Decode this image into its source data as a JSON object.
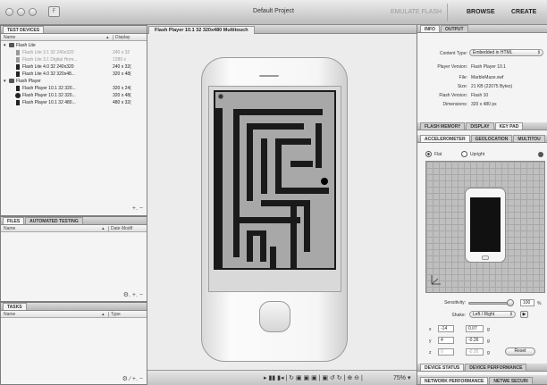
{
  "window": {
    "title": "Default Project",
    "emulate_label": "EMULATE FLASH",
    "browse_label": "BROWSE",
    "create_label": "CREATE",
    "app_icon_glyph": "F"
  },
  "left": {
    "test_devices": {
      "tab": "TEST DEVICES",
      "col_name": "Name",
      "col_display": "Display",
      "groups": [
        {
          "label": "Flash Lite",
          "items": [
            {
              "name": "Flash Lite 3.1 32 240x320",
              "display": "240 x 32",
              "dim": true
            },
            {
              "name": "Flash Lite 3.1 Digital Hom...",
              "display": "1280 x",
              "dim": true
            },
            {
              "name": "Flash Lite 4.0 32 240x320",
              "display": "240 x 32(",
              "dim": false
            },
            {
              "name": "Flash Lite 4.0 32 320x48...",
              "display": "320 x 48(",
              "dim": false
            }
          ]
        },
        {
          "label": "Flash Player",
          "items": [
            {
              "name": "Flash Player 10.1 32 320...",
              "display": "320 x 24(",
              "dim": false
            },
            {
              "name": "Flash Player 10.1 32 320...",
              "display": "320 x 48(",
              "dim": false
            },
            {
              "name": "Flash Player 10.1 32 480...",
              "display": "480 x 32(",
              "dim": false
            }
          ]
        }
      ],
      "footer": "+.  −"
    },
    "files": {
      "tab1": "FILES",
      "tab2": "AUTOMATED TESTING",
      "col_name": "Name",
      "col_date": "Date Modif",
      "footer": "⚙.  +.  −"
    },
    "tasks": {
      "tab": "TASKS",
      "col_name": "Name",
      "col_type": "Type",
      "footer": "⚙  ∕  +.  −"
    }
  },
  "center": {
    "tab": "Flash Player 10.1 32 320x480 Multitouch",
    "playback": {
      "controls": "▸  ▮▮  ▮◂  |  ↻  ▣  ▣  ▣  |  ▣  ↺  ↻  |  ⊕  ⊖  |",
      "zoom": "75% ▾"
    }
  },
  "right": {
    "info_tab": "INFO",
    "output_tab": "OUTPUT",
    "content_type_label": "Content Type:",
    "content_type_value": "Embedded in HTML",
    "player_version_label": "Player Version:",
    "player_version_value": "Flash Player 10.1",
    "file_label": "File:",
    "file_value": "MarbleMaze.swf",
    "size_label": "Size:",
    "size_value": "21 KB (22075 Bytes)",
    "flash_version_label": "Flash Version:",
    "flash_version_value": "Flash 10",
    "dimensions_label": "Dimensions:",
    "dimensions_value": "320 x 480 px",
    "tabs2": [
      "FLASH MEMORY",
      "DISPLAY",
      "KEY PAD"
    ],
    "tabs3": [
      "ACCELEROMETER",
      "GEOLOCATION",
      "MULTITOU"
    ],
    "flat_label": "Flat",
    "upright_label": "Upright",
    "sensitivity_label": "Sensitivity:",
    "sensitivity_value": "100",
    "sensitivity_unit": "%",
    "shake_label": "Shake:",
    "shake_value": "Left / Right",
    "axes": [
      {
        "axis": "x",
        "deg": "-14",
        "g": "0.07",
        "unit": "g"
      },
      {
        "axis": "y",
        "deg": "4",
        "g": "-0.26",
        "unit": "g"
      },
      {
        "axis": "z",
        "deg": "0",
        "g": "-0.95",
        "unit": "g"
      }
    ],
    "reset_label": "Reset",
    "bottom_tabs1": [
      "DEVICE STATUS",
      "DEVICE PERFORMANCE"
    ],
    "bottom_tabs2": [
      "NETWORK PERFORMANCE",
      "NETWE SECURI"
    ]
  }
}
